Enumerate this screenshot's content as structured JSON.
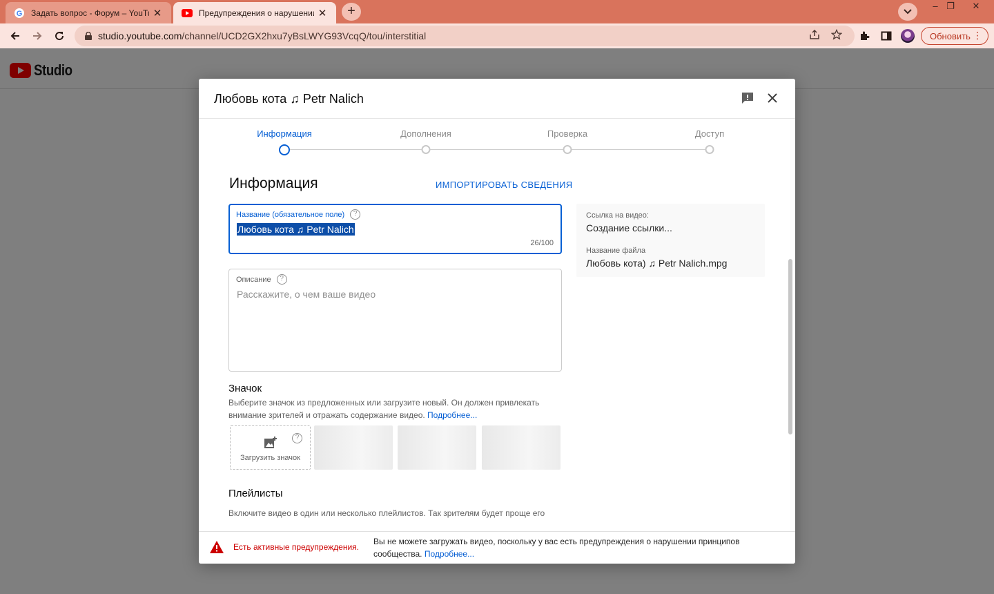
{
  "browser": {
    "tabs": [
      {
        "title": "Задать вопрос - Форум – YouTube",
        "icon": "google-icon",
        "active": false
      },
      {
        "title": "Предупреждения о нарушении",
        "icon": "youtube-icon",
        "active": true
      }
    ],
    "new_tab_label": "+",
    "url_host": "studio.youtube.com",
    "url_path": "/channel/UCD2GX2hxu7yBsLWYG93VcqQ/tou/interstitial",
    "update_button_label": "Обновить",
    "menu_label": "⋮"
  },
  "studio": {
    "logo_text": "Studio"
  },
  "dialog": {
    "title": "Любовь кота ♫ Petr Nalich",
    "steps": [
      {
        "label": "Информация",
        "active": true
      },
      {
        "label": "Дополнения",
        "active": false
      },
      {
        "label": "Проверка",
        "active": false
      },
      {
        "label": "Доступ",
        "active": false
      }
    ],
    "section_title": "Информация",
    "import_label": "ИМПОРТИРОВАТЬ СВЕДЕНИЯ",
    "title_field": {
      "label": "Название (обязательное поле)",
      "value": "Любовь кота ♫ Petr Nalich",
      "counter": "26/100"
    },
    "description_field": {
      "label": "Описание",
      "placeholder": "Расскажите, о чем ваше видео"
    },
    "side": {
      "link_label": "Ссылка на видео:",
      "link_value": "Создание ссылки...",
      "file_label": "Название файла",
      "file_value": "Любовь кота) ♫ Petr Nalich.mpg"
    },
    "thumbnail": {
      "title": "Значок",
      "desc": "Выберите значок из предложенных или загрузите новый. Он должен привлекать внимание зрителей и отражать содержание видео.",
      "more": "Подробнее...",
      "upload_label": "Загрузить значок"
    },
    "playlists": {
      "title": "Плейлисты",
      "desc": "Включите видео в один или несколько плейлистов. Так зрителям будет проще его"
    },
    "warning": {
      "title": "Есть активные предупреждения.",
      "text": "Вы не можете загружать видео, поскольку у вас есть предупреждения о нарушении принципов сообщества.",
      "more": "Подробнее..."
    }
  },
  "colors": {
    "accent": "#065fd4",
    "warning": "#cc0000",
    "chrome_tabbar": "#d9735c"
  }
}
